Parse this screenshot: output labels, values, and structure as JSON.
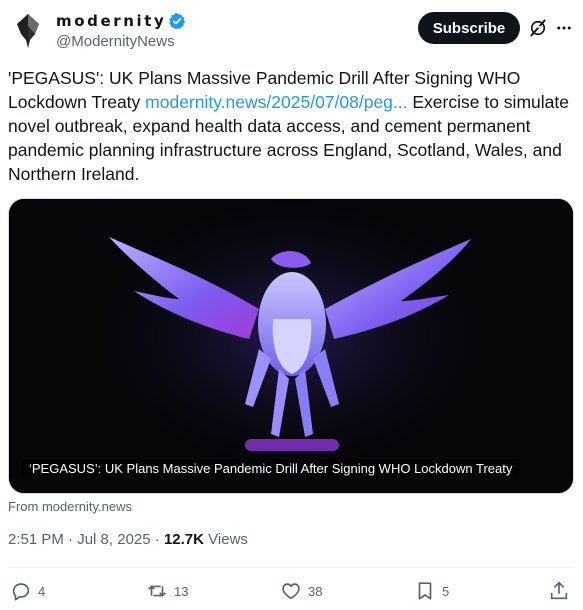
{
  "header": {
    "display_name": "modernity",
    "handle": "@ModernityNews",
    "subscribe_label": "Subscribe",
    "verified": true,
    "verified_color": "#1d9bf0"
  },
  "post": {
    "text_before": "'PEGASUS': UK Plans Massive Pandemic Drill After Signing WHO Lockdown Treaty ",
    "link_text": "modernity.news/2025/07/08/peg...",
    "text_after": " Exercise to simulate novel outbreak, expand health data access, and cement permanent pandemic planning infrastructure across England, Scotland, Wales, and Northern Ireland."
  },
  "card": {
    "caption": "‘PEGASUS’: UK Plans Massive Pandemic Drill After Signing WHO Lockdown Treaty",
    "source": "From modernity.news"
  },
  "meta": {
    "time": "2:51 PM",
    "date": "Jul 8, 2025",
    "views_count": "12.7K",
    "views_label": "Views"
  },
  "actions": {
    "replies": "4",
    "reposts": "13",
    "likes": "38",
    "bookmarks": "5"
  },
  "colors": {
    "text": "#0f1419",
    "secondary": "#536471",
    "link": "#1d9bf0",
    "button_bg": "#0f1419"
  },
  "icons": [
    "avatar-logo",
    "verified-badge-icon",
    "grok-icon",
    "more-icon",
    "reply-icon",
    "repost-icon",
    "like-icon",
    "bookmark-icon",
    "share-icon"
  ]
}
